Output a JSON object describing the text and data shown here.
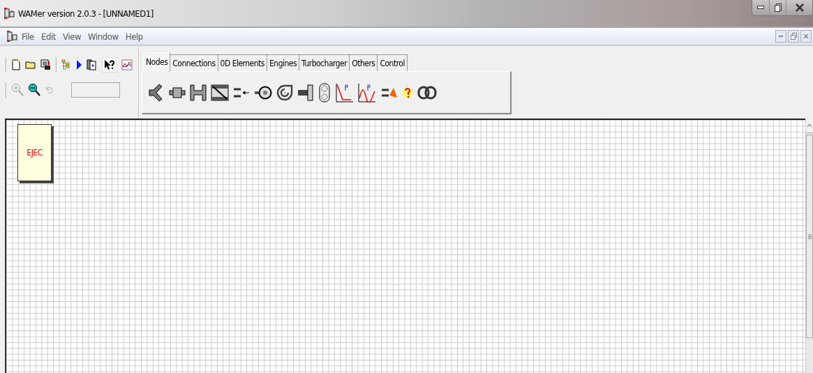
{
  "window": {
    "title": "WAMer version 2.0.3 - [UNNAMED1]"
  },
  "menu": [
    "File",
    "Edit",
    "View",
    "Window",
    "Help"
  ],
  "tabs": [
    {
      "label": "Nodes",
      "selected": true
    },
    {
      "label": "Connections",
      "selected": false
    },
    {
      "label": "0D Elements",
      "selected": false
    },
    {
      "label": "Engines",
      "selected": false
    },
    {
      "label": "Turbocharger",
      "selected": false
    },
    {
      "label": "Others",
      "selected": false
    },
    {
      "label": "Control",
      "selected": false
    }
  ],
  "canvas": {
    "blocks": [
      {
        "label": "EJEC"
      }
    ]
  }
}
